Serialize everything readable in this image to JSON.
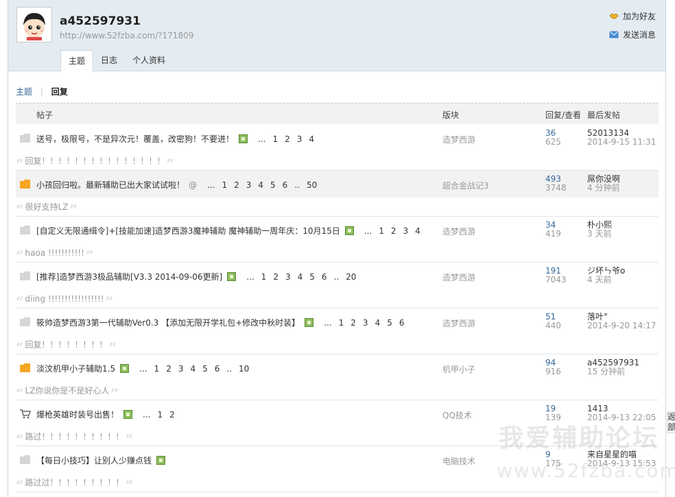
{
  "profile": {
    "username": "a452597931",
    "url": "http://www.52fzba.com/?171809",
    "add_friend": "加为好友",
    "send_message": "发送消息"
  },
  "tabs": [
    "主题",
    "日志",
    "个人资料"
  ],
  "subnav": {
    "topics": "主题",
    "sep": "|",
    "replies": "回复"
  },
  "table": {
    "headers": {
      "post": "帖子",
      "forum": "版块",
      "stats": "回复/查看",
      "last": "最后发帖"
    },
    "rows": [
      {
        "title": "送号，极限号，不是异次元！覆盖，改密狗！不要进！",
        "pages": [
          "...",
          "1",
          "2",
          "3",
          "4"
        ],
        "forum": "造梦西游",
        "replies": "36",
        "views": "625",
        "last_user": "52013134",
        "last_time": "2014-9-15 11:31",
        "reply": "回复！！！！！！！！！！！！！！！"
      },
      {
        "title": "小孩回归啦。最新辅助已出大家试试啦！",
        "pages": [
          "...",
          "1",
          "2",
          "3",
          "4",
          "5",
          "6",
          "..",
          "50"
        ],
        "forum": "超合金战记3",
        "replies": "493",
        "views": "3748",
        "last_user": "屌你没啊",
        "last_time": "4 分钟前",
        "reply": "很好支持LZ"
      },
      {
        "title": "[自定义无限通缉令]+[技能加速]造梦西游3魔神辅助 魔神辅助一周年庆：10月15日",
        "pages": [
          "...",
          "1",
          "2",
          "3",
          "4"
        ],
        "forum": "造梦西游",
        "replies": "34",
        "views": "419",
        "last_user": "朴小熙",
        "last_time": "3 天前",
        "reply": "haoa !!!!!!!!!!!"
      },
      {
        "title": "[推荐]造梦西游3极品辅助[V3.3 2014-09-06更新]",
        "pages": [
          "...",
          "1",
          "2",
          "3",
          "4",
          "5",
          "6",
          "..",
          "20"
        ],
        "forum": "造梦西游",
        "replies": "191",
        "views": "7043",
        "last_user": "ジ坏ㄣ爷o",
        "last_time": "4 天前",
        "reply": "diing !!!!!!!!!!!!!!!!!"
      },
      {
        "title": "筱帅造梦西游3第一代辅助Ver0.3 【添加无限开学礼包+修改中秋时装】",
        "pages": [
          "...",
          "1",
          "2",
          "3",
          "4",
          "5",
          "6"
        ],
        "forum": "造梦西游",
        "replies": "51",
        "views": "440",
        "last_user": "落叶°",
        "last_time": "2014-9-20 14:17",
        "reply": "回复！！！！！！！！"
      },
      {
        "title": "淡汶机甲小子辅助1.5",
        "pages": [
          "...",
          "1",
          "2",
          "3",
          "4",
          "5",
          "6",
          "..",
          "10"
        ],
        "forum": "机甲小子",
        "replies": "94",
        "views": "916",
        "last_user": "a452597931",
        "last_time": "15 分钟前",
        "reply": "LZ你说你是不是好心人"
      },
      {
        "title": "爆枪英雄时装号出售！",
        "pages": [
          "...",
          "1",
          "2"
        ],
        "forum": "QQ技术",
        "replies": "19",
        "views": "139",
        "last_user": "1413",
        "last_time": "2014-9-13 22:05",
        "reply": "路过！！！！！！！！！！"
      },
      {
        "title": "【每日小技巧】让别人少赚点钱",
        "pages": [],
        "forum": "电脑技术",
        "replies": "9",
        "views": "175",
        "last_user": "来自星星的喵",
        "last_time": "2014-9-13 15:53",
        "reply": "路过过！！！！！！！！！"
      }
    ]
  },
  "watermark": {
    "line1": "我爱辅助论坛",
    "line2": "www.52fzba.com"
  },
  "side_tab": "返部",
  "colors": {
    "header_bg": "#e4ecf2",
    "link": "#336699",
    "folder_gray": "#d6d6d6",
    "folder_orange": "#f5a623"
  }
}
